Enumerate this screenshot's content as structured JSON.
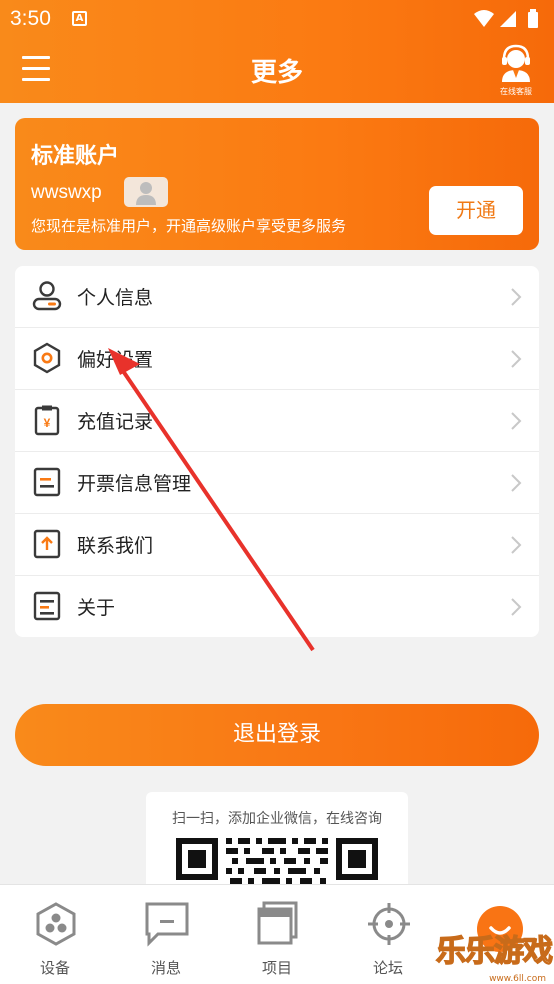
{
  "status_bar": {
    "time": "3:50",
    "notification": "A"
  },
  "navbar": {
    "title": "更多",
    "service_label": "在线客服"
  },
  "account": {
    "title": "标准账户",
    "username": "wwswxp",
    "description": "您现在是标准用户，开通高级账户享受更多服务",
    "open_button": "开通"
  },
  "menu": {
    "items": [
      {
        "label": "个人信息",
        "icon": "user-icon"
      },
      {
        "label": "偏好设置",
        "icon": "preference-hexagon-icon"
      },
      {
        "label": "充值记录",
        "icon": "recharge-clipboard-icon"
      },
      {
        "label": "开票信息管理",
        "icon": "invoice-icon"
      },
      {
        "label": "联系我们",
        "icon": "contact-upload-icon"
      },
      {
        "label": "关于",
        "icon": "about-icon"
      }
    ]
  },
  "logout_button": "退出登录",
  "qr": {
    "text": "扫一扫，添加企业微信，在线咨询"
  },
  "tabbar": {
    "tabs": [
      {
        "label": "设备",
        "icon": "device-hexagon-icon"
      },
      {
        "label": "消息",
        "icon": "message-icon"
      },
      {
        "label": "项目",
        "icon": "project-icon"
      },
      {
        "label": "论坛",
        "icon": "forum-target-icon"
      },
      {
        "label": "",
        "icon": "me-smile-icon"
      }
    ]
  },
  "watermark": {
    "text": "乐乐游戏",
    "url": "www.6ll.com"
  },
  "colors": {
    "accent": "#f97a14",
    "icon_gray": "#555555",
    "bg": "#f2f2f2"
  }
}
